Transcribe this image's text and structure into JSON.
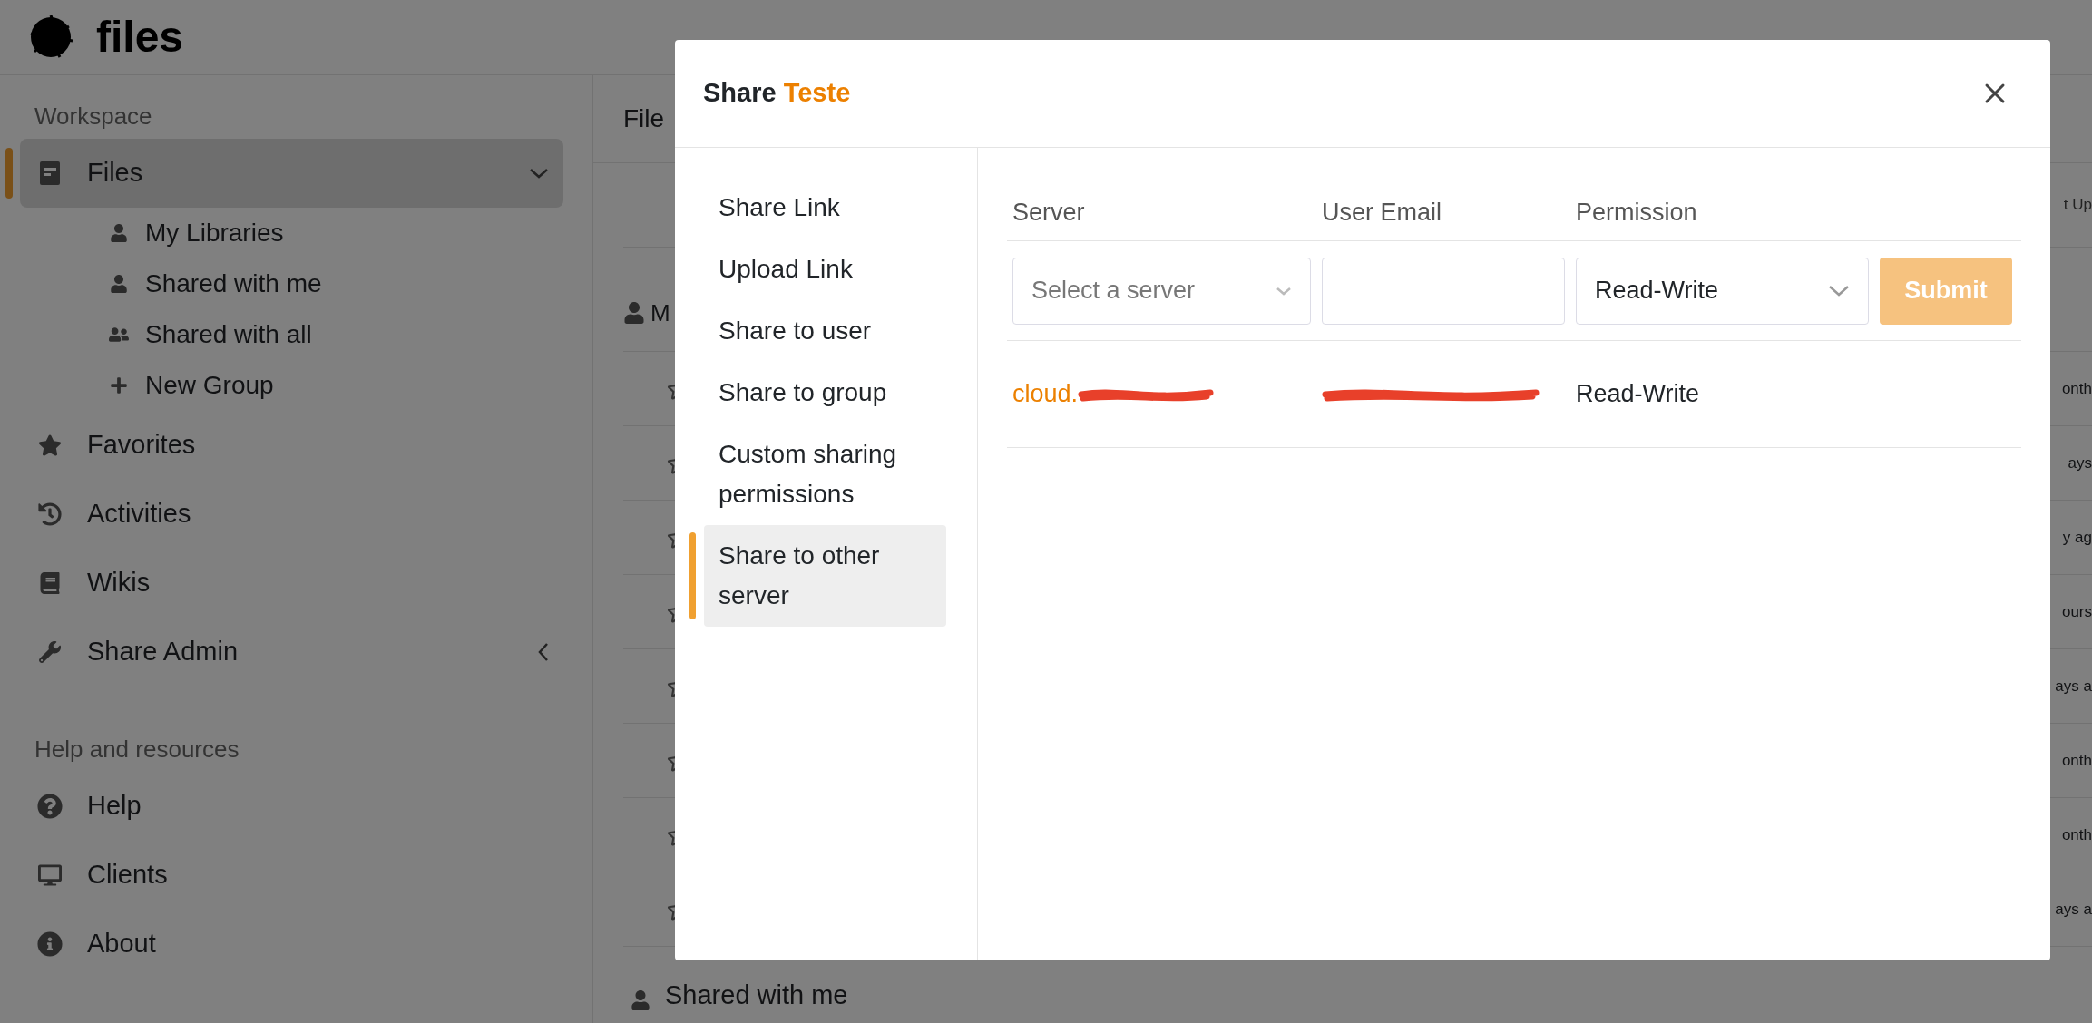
{
  "app": {
    "logo_text": "files"
  },
  "sidebar": {
    "sections": [
      {
        "heading": "Workspace",
        "items": [
          {
            "label": "Files",
            "kind": "group",
            "selected": true,
            "expanded": true,
            "children": [
              {
                "label": "My Libraries"
              },
              {
                "label": "Shared with me"
              },
              {
                "label": "Shared with all"
              },
              {
                "label": "New Group"
              }
            ]
          },
          {
            "label": "Favorites",
            "kind": "link",
            "selected": false
          },
          {
            "label": "Activities",
            "kind": "link",
            "selected": false
          },
          {
            "label": "Wikis",
            "kind": "link",
            "selected": false
          },
          {
            "label": "Share Admin",
            "kind": "group",
            "selected": false,
            "expanded": false
          }
        ]
      },
      {
        "heading": "Help and resources",
        "items": [
          {
            "label": "Help",
            "kind": "link",
            "selected": false
          },
          {
            "label": "Clients",
            "kind": "link",
            "selected": false
          },
          {
            "label": "About",
            "kind": "link",
            "selected": false
          }
        ]
      }
    ]
  },
  "main": {
    "title": "File",
    "column_header": "t Up",
    "section_heading": "M",
    "rows": [
      "onth",
      "ays",
      "y ag",
      "ours",
      "ays a",
      "onth",
      "onth",
      "ays a"
    ],
    "next_section": "Shared with me"
  },
  "modal": {
    "title": "Share",
    "file_name": "Teste",
    "nav": [
      {
        "label": "Share Link",
        "selected": false
      },
      {
        "label": "Upload Link",
        "selected": false
      },
      {
        "label": "Share to user",
        "selected": false
      },
      {
        "label": "Share to group",
        "selected": false
      },
      {
        "label": "Custom sharing permissions",
        "selected": false
      },
      {
        "label": "Share to other server",
        "selected": true
      }
    ],
    "table": {
      "columns": [
        "Server",
        "User Email",
        "Permission"
      ],
      "form": {
        "server_placeholder": "Select a server",
        "permission": "Read-Write",
        "submit": "Submit",
        "submit_disabled": true
      },
      "rows": [
        {
          "server": "cloud.",
          "permission": "Read-Write"
        }
      ]
    }
  }
}
